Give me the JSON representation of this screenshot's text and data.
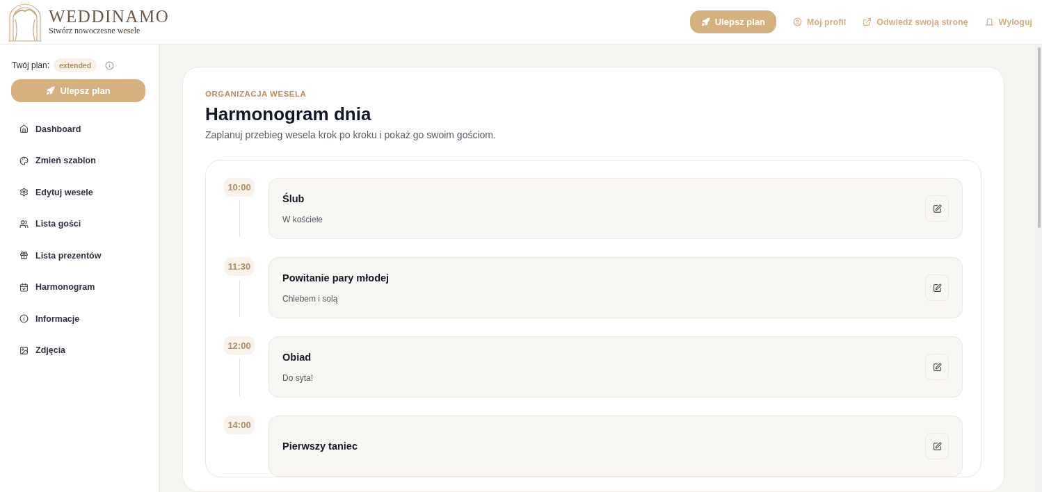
{
  "brand": {
    "name": "WEDDINAMO",
    "tagline": "Stwórz nowoczesne wesele"
  },
  "top_nav": {
    "upgrade": "Ulepsz plan",
    "links": [
      {
        "kind": "profile",
        "label": "Mój profil"
      },
      {
        "kind": "external",
        "label": "Odwiedź swoją stronę"
      },
      {
        "kind": "logout",
        "label": "Wyloguj"
      }
    ]
  },
  "sidebar": {
    "plan_label": "Twój plan:",
    "plan": "extended",
    "upgrade": "Ulepsz plan",
    "items": [
      {
        "kind": "home",
        "label": "Dashboard"
      },
      {
        "kind": "palette",
        "label": "Zmień szablon"
      },
      {
        "kind": "gear",
        "label": "Edytuj wesele"
      },
      {
        "kind": "users",
        "label": "Lista gości"
      },
      {
        "kind": "gift",
        "label": "Lista prezentów"
      },
      {
        "kind": "calendar",
        "label": "Harmonogram"
      },
      {
        "kind": "info",
        "label": "Informacje"
      },
      {
        "kind": "image",
        "label": "Zdjęcia"
      }
    ]
  },
  "page": {
    "eyebrow": "ORGANIZACJA WESELA",
    "title": "Harmonogram dnia",
    "subtitle": "Zaplanuj przebieg wesela krok po kroku i pokaż go swoim gościom."
  },
  "schedule": [
    {
      "time": "10:00",
      "title": "Ślub",
      "description": "W kościele"
    },
    {
      "time": "11:30",
      "title": "Powitanie pary młodej",
      "description": "Chlebem i solą"
    },
    {
      "time": "12:00",
      "title": "Obiad",
      "description": "Do syta!"
    },
    {
      "time": "14:00",
      "title": "Pierwszy taniec"
    }
  ]
}
